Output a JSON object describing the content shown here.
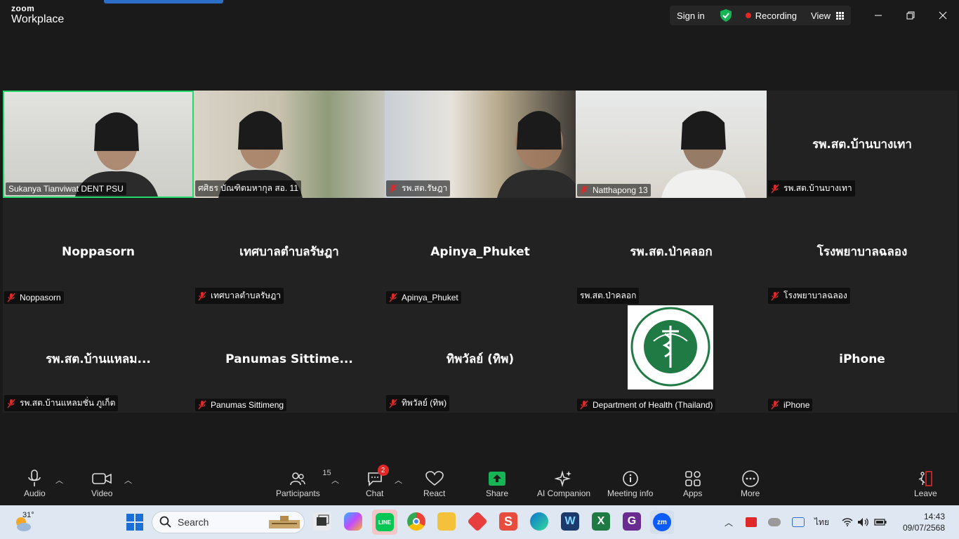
{
  "app": {
    "brand_top": "zoom",
    "brand_bottom": "Workplace"
  },
  "titlebar": {
    "signin": "Sign in",
    "recording": "Recording",
    "view": "View"
  },
  "participants": [
    {
      "name": "Sukanya Tianviwat DENT PSU",
      "display": "",
      "video": true,
      "muted": false,
      "active": true
    },
    {
      "name": "ศศิธร บัณฑิตมหากุล สอ. 11",
      "display": "",
      "video": true,
      "muted": false,
      "active": false
    },
    {
      "name": "รพ.สต.รัษฎา",
      "display": "",
      "video": true,
      "muted": true,
      "active": false
    },
    {
      "name": "Natthapong 13",
      "display": "",
      "video": true,
      "muted": true,
      "active": false
    },
    {
      "name": "รพ.สต.บ้านบางเทา",
      "display": "รพ.สต.บ้านบางเทา",
      "video": false,
      "muted": true,
      "active": false
    },
    {
      "name": "Noppasorn",
      "display": "Noppasorn",
      "video": false,
      "muted": true,
      "active": false
    },
    {
      "name": "เทศบาลตำบลรัษฎา",
      "display": "เทศบาลตำบลรัษฎา",
      "video": false,
      "muted": true,
      "active": false
    },
    {
      "name": "Apinya_Phuket",
      "display": "Apinya_Phuket",
      "video": false,
      "muted": true,
      "active": false
    },
    {
      "name": "รพ.สต.ป่าคลอก",
      "display": "รพ.สต.ป่าคลอก",
      "video": false,
      "muted": false,
      "active": false
    },
    {
      "name": "โรงพยาบาลฉลอง",
      "display": "โรงพยาบาลฉลอง",
      "video": false,
      "muted": true,
      "active": false
    },
    {
      "name": "รพ.สต.บ้านแหลมชั่น ภูเก็ต",
      "display": "รพ.สต.บ้านแหลม...",
      "video": false,
      "muted": true,
      "active": false
    },
    {
      "name": "Panumas Sittimeng",
      "display": "Panumas  Sittime...",
      "video": false,
      "muted": true,
      "active": false
    },
    {
      "name": "ทิพวัลย์ (ทิพ)",
      "display": "ทิพวัลย์ (ทิพ)",
      "video": false,
      "muted": true,
      "active": false
    },
    {
      "name": "Department of Health (Thailand)",
      "display": "",
      "video": false,
      "muted": true,
      "active": false,
      "logo_text": "กระทรวงสาธารณสุข",
      "logo_sub": "MINISTRY OF PUBLIC HEALTH"
    },
    {
      "name": "iPhone",
      "display": "iPhone",
      "video": false,
      "muted": true,
      "active": false
    }
  ],
  "toolbar": {
    "audio": "Audio",
    "video": "Video",
    "participants": "Participants",
    "participants_count": "15",
    "chat": "Chat",
    "chat_badge": "2",
    "react": "React",
    "share": "Share",
    "ai_companion": "AI Companion",
    "meeting_info": "Meeting info",
    "apps": "Apps",
    "more": "More",
    "leave": "Leave"
  },
  "taskbar": {
    "weather": "31°",
    "search_placeholder": "Search",
    "lang": "ไทย",
    "time": "14:43",
    "date": "09/07/2568"
  },
  "colors": {
    "active_border": "#23d96b",
    "share_green": "#17b455",
    "record_red": "#e02828"
  }
}
